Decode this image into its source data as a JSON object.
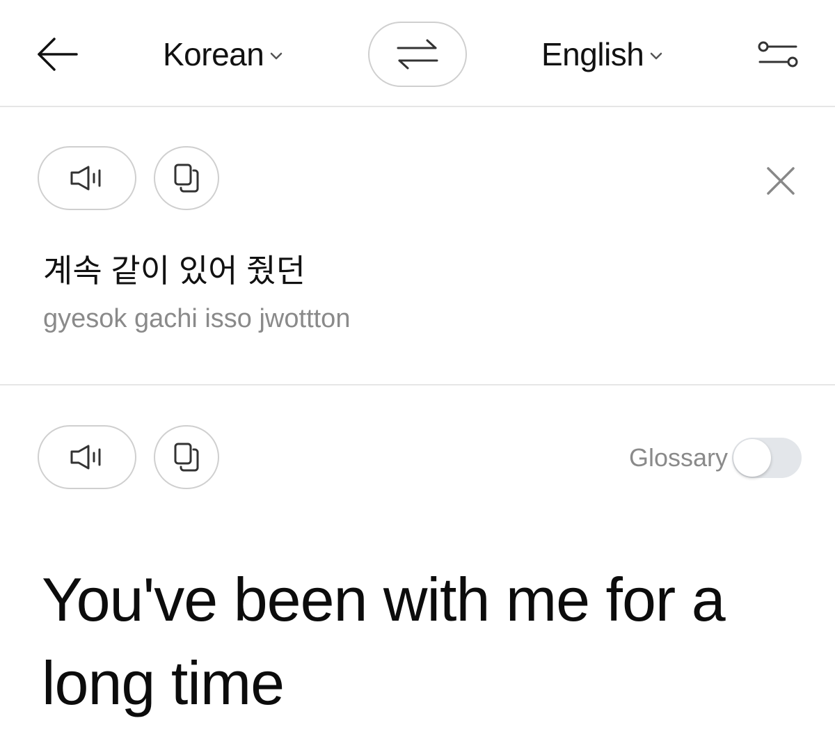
{
  "header": {
    "back_icon": "arrow-left-icon",
    "source_language": "Korean",
    "target_language": "English",
    "swap_icon": "swap-arrows-icon",
    "settings_icon": "sliders-icon"
  },
  "source": {
    "text": "계속 같이 있어 줬던",
    "romanization": "gyesok gachi isso jwottton",
    "speak_icon": "speaker-icon",
    "copy_icon": "copy-icon",
    "clear_icon": "close-icon"
  },
  "target": {
    "text": "You've been with me for a long time",
    "speak_icon": "speaker-icon",
    "copy_icon": "copy-icon",
    "glossary_label": "Glossary",
    "glossary_enabled": false
  },
  "colors": {
    "text_primary": "#111111",
    "text_secondary": "#8a8a8a",
    "border": "#cfcfcf",
    "divider": "#e6e6e6",
    "toggle_off": "#e3e6ea"
  }
}
